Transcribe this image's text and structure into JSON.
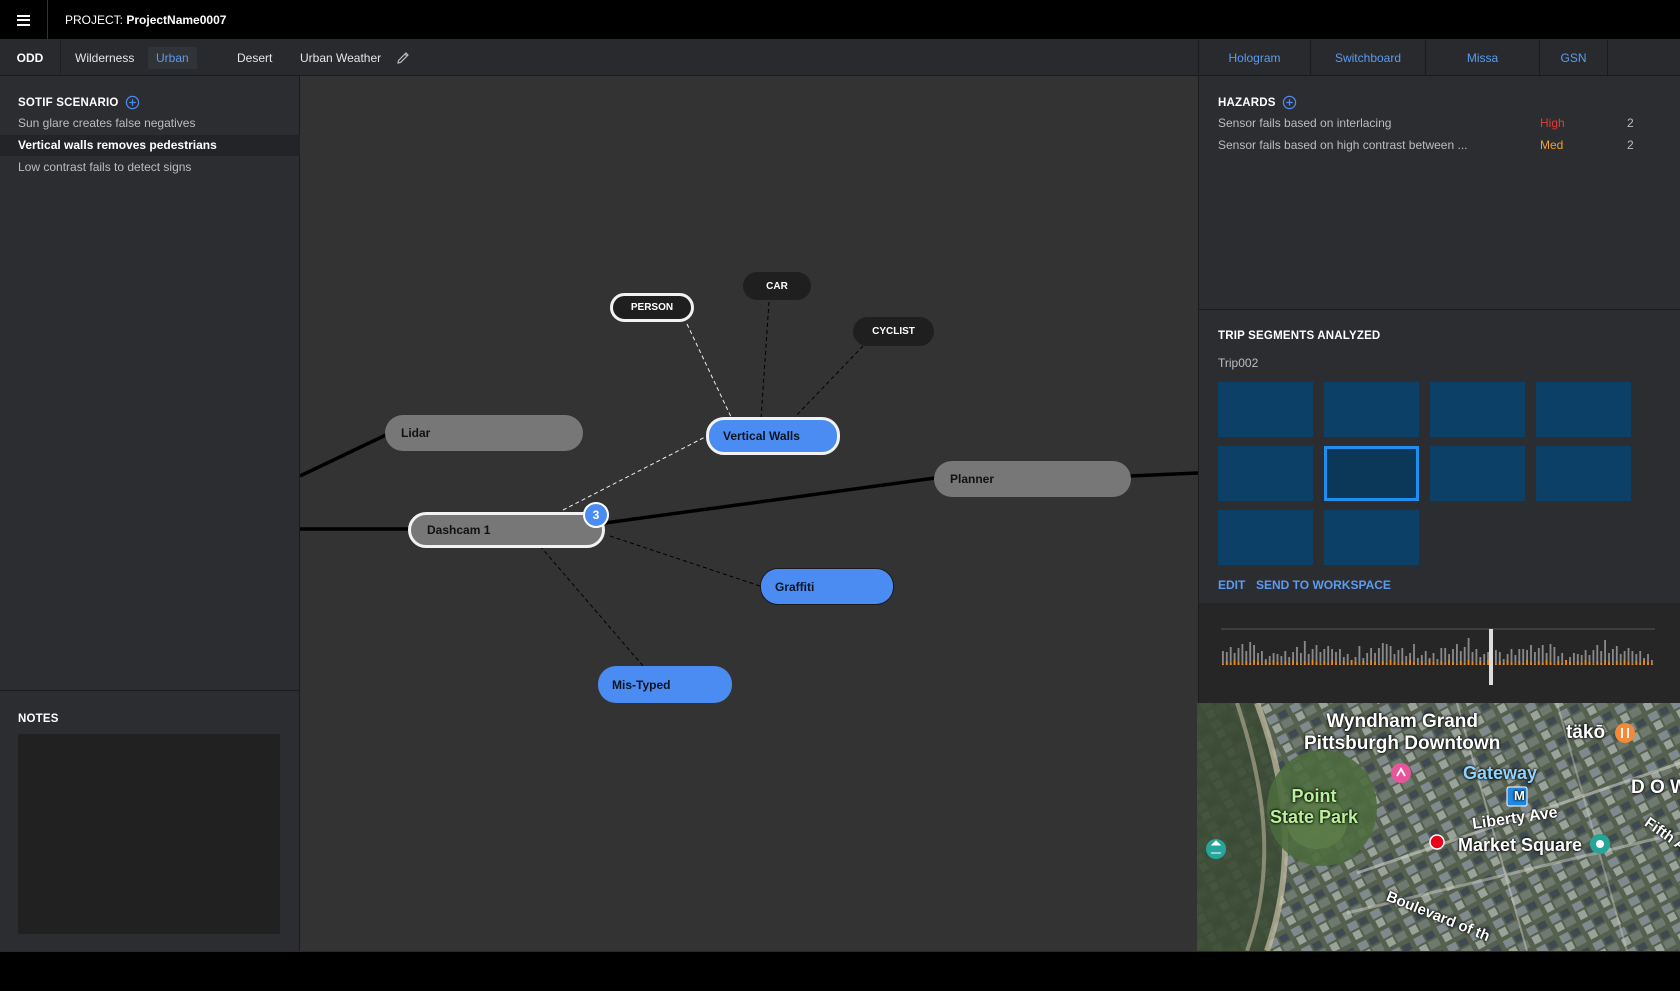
{
  "header": {
    "project_prefix": "PROJECT:",
    "project_name": "ProjectName0007"
  },
  "odd": {
    "label": "ODD",
    "tabs": [
      {
        "label": "Wilderness",
        "active": false
      },
      {
        "label": "Urban",
        "active": true
      },
      {
        "label": "Desert",
        "active": false
      },
      {
        "label": "Urban Weather",
        "active": false
      }
    ]
  },
  "right_tabs": [
    "Hologram",
    "Switchboard",
    "Missa",
    "GSN"
  ],
  "sotif": {
    "title": "SOTIF SCENARIO",
    "items": [
      {
        "label": "Sun glare creates false negatives",
        "selected": false
      },
      {
        "label": "Vertical walls removes pedestrians",
        "selected": true
      },
      {
        "label": "Low contrast fails to detect signs",
        "selected": false
      }
    ]
  },
  "notes": {
    "title": "NOTES",
    "value": ""
  },
  "graph": {
    "nodes": {
      "person": "PERSON",
      "car": "CAR",
      "cyclist": "CYCLIST",
      "lidar": "Lidar",
      "vertical_walls": "Vertical Walls",
      "planner": "Planner",
      "dashcam": "Dashcam 1",
      "graffiti": "Graffiti",
      "mistyped": "Mis-Typed"
    },
    "dashcam_badge": "3"
  },
  "hazards": {
    "title": "HAZARDS",
    "rows": [
      {
        "desc": "Sensor fails based on interlacing",
        "severity": "High",
        "count": "2",
        "color": "#e53935"
      },
      {
        "desc": "Sensor fails based on high contrast between ...",
        "severity": "Med",
        "count": "2",
        "color": "#f0a030"
      }
    ]
  },
  "trips": {
    "title": "TRIP SEGMENTS ANALYZED",
    "trip": "Trip002",
    "segment_count": 10,
    "selected_segment": 5,
    "edit_label": "EDIT",
    "send_label": "SEND TO WORKSPACE"
  },
  "map": {
    "labels": {
      "hotel": "Wyndham Grand\nPittsburgh Downtown",
      "tako": "täkō",
      "gateway": "Gateway",
      "park": "Point\nState Park",
      "liberty": "Liberty Ave",
      "market": "Market Square",
      "boulevard": "Boulevard of th",
      "downtown": "D O W",
      "fifth": "Fifth A",
      "metro": "M"
    }
  },
  "colors": {
    "accent": "#4b8cf3",
    "link": "#5b9bf0",
    "high": "#e53935",
    "med": "#f0a030",
    "thumb": "#0c4066",
    "orange_bar": "#e8891e"
  }
}
